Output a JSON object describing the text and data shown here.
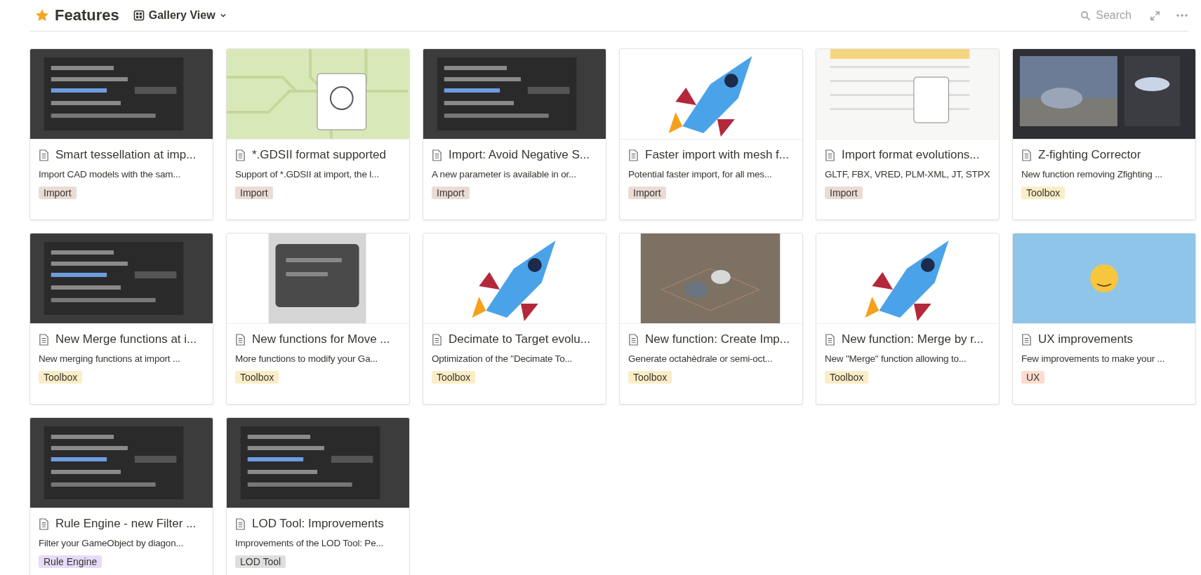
{
  "header": {
    "title": "Features",
    "view": "Gallery View",
    "search": "Search"
  },
  "cards": [
    {
      "title": "Smart tessellation at imp...",
      "description": "Import CAD models with the sam...",
      "tag": {
        "label": "Import",
        "color": "#eadbd5"
      }
    },
    {
      "title": "*.GDSII format supported",
      "description": "Support of *.GDSII at import, the l...",
      "tag": {
        "label": "Import",
        "color": "#eadbd5"
      }
    },
    {
      "title": "Import: Avoid Negative S...",
      "description": "A new parameter is available in or...",
      "tag": {
        "label": "Import",
        "color": "#eadbd5"
      }
    },
    {
      "title": "Faster import with mesh f...",
      "description": "Potential faster import, for all mes...",
      "tag": {
        "label": "Import",
        "color": "#eadbd5"
      }
    },
    {
      "title": "Import format evolutions...",
      "description": "GLTF, FBX, VRED, PLM-XML, JT, STPX",
      "tag": {
        "label": "Import",
        "color": "#eadbd5"
      }
    },
    {
      "title": "Z-fighting Corrector",
      "description": "New function removing Zfighting ...",
      "tag": {
        "label": "Toolbox",
        "color": "#fbedc7"
      }
    },
    {
      "title": "New Merge functions at i...",
      "description": "New merging functions at import ...",
      "tag": {
        "label": "Toolbox",
        "color": "#fbedc7"
      }
    },
    {
      "title": "New functions for Move ...",
      "description": "More functions to modify your Ga...",
      "tag": {
        "label": "Toolbox",
        "color": "#fbedc7"
      }
    },
    {
      "title": "Decimate to Target evolu...",
      "description": "Optimization of the \"Decimate To...",
      "tag": {
        "label": "Toolbox",
        "color": "#fbedc7"
      }
    },
    {
      "title": "New function: Create Imp...",
      "description": "Generate octahèdrale or semi-oct...",
      "tag": {
        "label": "Toolbox",
        "color": "#fbedc7"
      }
    },
    {
      "title": "New function: Merge by r...",
      "description": "New \"Merge\" function allowing to...",
      "tag": {
        "label": "Toolbox",
        "color": "#fbedc7"
      }
    },
    {
      "title": "UX improvements",
      "description": "Few improvements to make your ...",
      "tag": {
        "label": "UX",
        "color": "#fbdccf"
      }
    },
    {
      "title": "Rule Engine - new Filter ...",
      "description": "Filter your GameObject by diagon...",
      "tag": {
        "label": "Rule Engine",
        "color": "#e6dbf8"
      }
    },
    {
      "title": "LOD Tool: Improvements",
      "description": "Improvements of the LOD Tool: Pe...",
      "tag": {
        "label": "LOD Tool",
        "color": "#dedede"
      }
    }
  ]
}
